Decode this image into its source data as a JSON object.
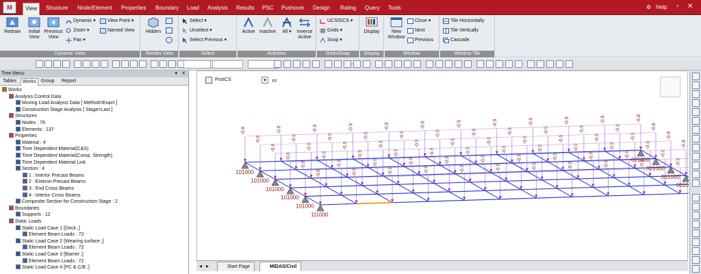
{
  "menu": {
    "tabs": [
      "View",
      "Structure",
      "Node/Element",
      "Properties",
      "Boundary",
      "Load",
      "Analysis",
      "Results",
      "PSC",
      "Pushover",
      "Design",
      "Rating",
      "Query",
      "Tools"
    ],
    "active": "View",
    "help": "Help"
  },
  "ribbon": {
    "dynamic_view": {
      "title": "Dynamic View",
      "redraw": "Redraw",
      "initial": "Initial\nView",
      "previous": "Previous\nView",
      "dynamic": "Dynamic",
      "zoom": "Zoom",
      "pan": "Pan",
      "view_point": "View Point",
      "named_view": "Named View"
    },
    "render_view": {
      "title": "Render View",
      "hidden": "Hidden"
    },
    "select": {
      "title": "Select",
      "select": "Select",
      "unselect": "Unselect",
      "select_previous": "Select Previous"
    },
    "activities": {
      "title": "Activities",
      "active": "Active",
      "inactive": "Inactive",
      "all": "All",
      "inverse": "Inverse\nActive"
    },
    "grids_snap": {
      "title": "Grids/Snap",
      "ucs": "UCS/GCS",
      "grids": "Grids",
      "snap": "Snap"
    },
    "display": {
      "title": "Display",
      "display": "Display"
    },
    "window": {
      "title": "Window",
      "new_window": "New\nWindow",
      "close": "Close",
      "next": "Next",
      "previous": "Previous"
    },
    "window_tile": {
      "title": "Window Tile",
      "horiz": "Tile Horizontally",
      "vert": "Tile Vertically",
      "cascade": "Cascade"
    }
  },
  "tree": {
    "title": "Tree Menu",
    "tabs": [
      "Tables",
      "Works",
      "Group",
      "Report"
    ],
    "active_tab": "Works",
    "rows": [
      {
        "text": "Works",
        "level": 0
      },
      {
        "text": "Analysis Control Data",
        "level": 1
      },
      {
        "text": "Moving Load Analysis Data [ Method=Exact ]",
        "level": 2
      },
      {
        "text": "Construction Stage Analysis [ Stage=Last ]",
        "level": 2
      },
      {
        "text": "Structures",
        "level": 1
      },
      {
        "text": "Nodes : 78",
        "level": 2
      },
      {
        "text": "Elements : 137",
        "level": 2
      },
      {
        "text": "Properties",
        "level": 1
      },
      {
        "text": "Material : 4",
        "level": 2
      },
      {
        "text": "Time Dependent Material(C&S)",
        "level": 2
      },
      {
        "text": "Time Dependent Material(Comp. Strength)",
        "level": 2
      },
      {
        "text": "Time Dependent Material Link",
        "level": 2
      },
      {
        "text": "Section : 4",
        "level": 2
      },
      {
        "text": "1 : Interior Precast Beams",
        "level": 3
      },
      {
        "text": "2 : Exterior Precast Beams",
        "level": 3
      },
      {
        "text": "3 : End Cross Beams",
        "level": 3
      },
      {
        "text": "4 : Interior Cross Beams",
        "level": 3
      },
      {
        "text": "Composite Section for Construction Stage : 2",
        "level": 2
      },
      {
        "text": "Boundaries",
        "level": 1
      },
      {
        "text": "Supports : 12",
        "level": 2
      },
      {
        "text": "Static Loads",
        "level": 1
      },
      {
        "text": "Static Load Case 1 [Deck ;]",
        "level": 2
      },
      {
        "text": "Element Beam Loads : 72",
        "level": 3
      },
      {
        "text": "Static Load Case 2 [Wearing surface ;]",
        "level": 2
      },
      {
        "text": "Element Beam Loads : 72",
        "level": 3
      },
      {
        "text": "Static Load Case 3 [Barrier ;]",
        "level": 2
      },
      {
        "text": "Element Beam Loads : 72",
        "level": 3
      },
      {
        "text": "Static Load Case 4 [PC & C/B ;]",
        "level": 2
      }
    ]
  },
  "viewport": {
    "stage": "PostCS",
    "load_value": "-0.8",
    "load_value_inner": "-0.9",
    "support_labels": [
      "101000",
      "101000",
      "101000",
      "101000",
      "101000",
      "111000",
      "001000",
      "001000",
      "001000",
      "001000",
      "001000",
      "011000"
    ]
  },
  "doc_tabs": [
    "Start Page",
    "MIDAS/Civil"
  ],
  "active_doc": "MIDAS/Civil"
}
